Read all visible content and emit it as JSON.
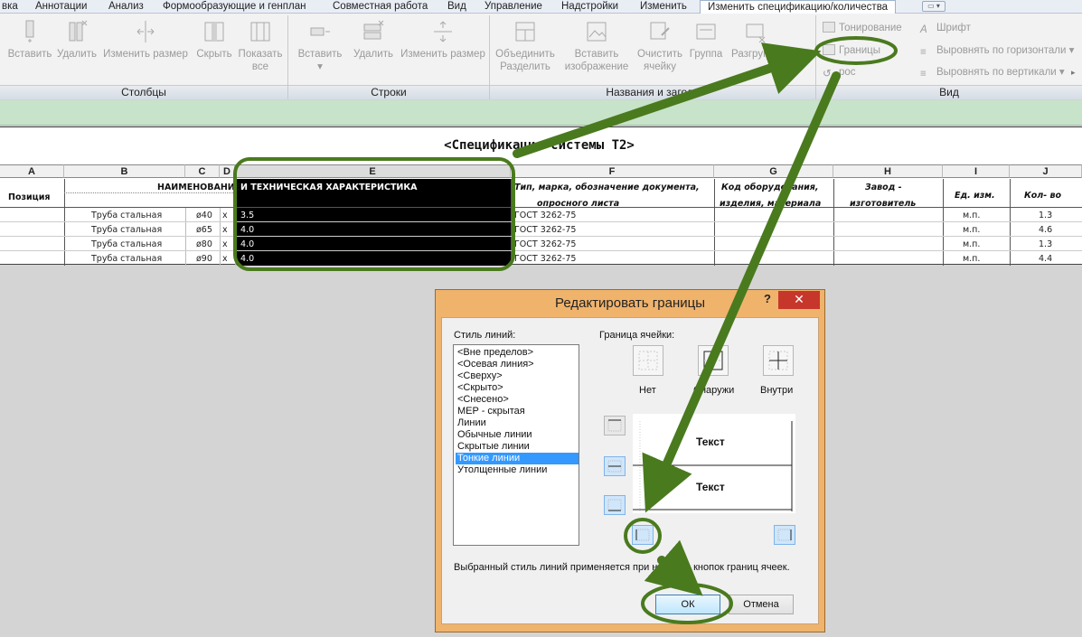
{
  "tabs": [
    {
      "label": "вка"
    },
    {
      "label": "Аннотации"
    },
    {
      "label": "Анализ"
    },
    {
      "label": "Формообразующие и генплан"
    },
    {
      "label": "Совместная работа"
    },
    {
      "label": "Вид"
    },
    {
      "label": "Управление"
    },
    {
      "label": "Надстройки"
    },
    {
      "label": "Изменить"
    },
    {
      "label": "Изменить спецификацию/количества"
    }
  ],
  "ribbon": {
    "columns_panel": {
      "title": "Столбцы",
      "buttons": [
        {
          "label": "Вставить"
        },
        {
          "label": "Удалить"
        },
        {
          "label": "Изменить размер"
        },
        {
          "label": "Скрыть"
        },
        {
          "label": "Показать",
          "label2": "все"
        }
      ]
    },
    "rows_panel": {
      "title": "Строки",
      "buttons": [
        {
          "label": "Вставить"
        },
        {
          "label": "Удалить"
        },
        {
          "label": "Изменить размер"
        }
      ]
    },
    "titles_panel": {
      "title": "Названия и заголо",
      "buttons": [
        {
          "label": "Объединить",
          "label2": "Разделить"
        },
        {
          "label": "Вставить",
          "label2": "изображение"
        },
        {
          "label": "Очистить",
          "label2": "ячейку"
        },
        {
          "label": "Группа"
        },
        {
          "label": "Разгруппи"
        }
      ]
    },
    "view_panel": {
      "title": "Вид",
      "shading": "Тонирование",
      "borders": "Границы",
      "reset": "рос",
      "font": "Шрифт",
      "align_h": "Выровнять  по горизонтали",
      "align_v": "Выровнять  по вертикали"
    }
  },
  "schedule": {
    "title": "<Спецификация системы Т2>",
    "columns": [
      "A",
      "B",
      "C",
      "D",
      "E",
      "F",
      "G",
      "H",
      "I",
      "J"
    ],
    "header": {
      "position": "Позиция",
      "name": "НАИМЕНОВАНИЕ",
      "name_tech": "И ТЕХНИЧЕСКАЯ ХАРАКТЕРИСТИКА",
      "type": "Тип, марка, обозначение документа,",
      "type2": "опросного листа",
      "code": "Код оборудования,",
      "code2": "изделия, материала",
      "maker": "Завод -",
      "maker2": "изготовитель",
      "unit": "Ед. изм.",
      "qty": "Кол- во"
    },
    "rows": [
      {
        "name": "Труба стальная",
        "dia": "ø40",
        "x": "x",
        "thk": "3.5",
        "doc": "ГОСТ 3262-75",
        "unit": "м.п.",
        "qty": "1.3"
      },
      {
        "name": "Труба стальная",
        "dia": "ø65",
        "x": "x",
        "thk": "4.0",
        "doc": "ГОСТ 3262-75",
        "unit": "м.п.",
        "qty": "4.6"
      },
      {
        "name": "Труба стальная",
        "dia": "ø80",
        "x": "x",
        "thk": "4.0",
        "doc": "ГОСТ 3262-75",
        "unit": "м.п.",
        "qty": "1.3"
      },
      {
        "name": "Труба стальная",
        "dia": "ø90",
        "x": "x",
        "thk": "4.0",
        "doc": "ГОСТ 3262-75",
        "unit": "м.п.",
        "qty": "4.4"
      }
    ]
  },
  "dialog": {
    "title": "Редактировать границы",
    "help": "?",
    "close": "✕",
    "line_style_label": "Стиль линий:",
    "line_styles": [
      "<Вне пределов>",
      "<Осевая линия>",
      "<Сверху>",
      "<Скрыто>",
      "<Снесено>",
      "MEP - скрытая",
      "Линии",
      "Обычные линии",
      "Скрытые линии",
      "Тонкие линии",
      "Утолщенные линии"
    ],
    "selected_style": "Тонкие линии",
    "cell_border_label": "Граница ячейки:",
    "preset_none": "Нет",
    "preset_outside": "Снаружи",
    "preset_inside": "Внутри",
    "preview_text_top": "Текст",
    "preview_text_bottom": "Текст",
    "hint": "Выбранный стиль линий применяется при нажатии кнопок границ ячеек.",
    "ok": "ОК",
    "cancel": "Отмена"
  },
  "colors": {
    "annotation_green": "#4a7a1e",
    "selection_bg": "#000000",
    "list_selection": "#3399ff",
    "close_red": "#c7362b",
    "dialog_frame": "#f0b36c",
    "strip_green": "#c7e3c9"
  }
}
